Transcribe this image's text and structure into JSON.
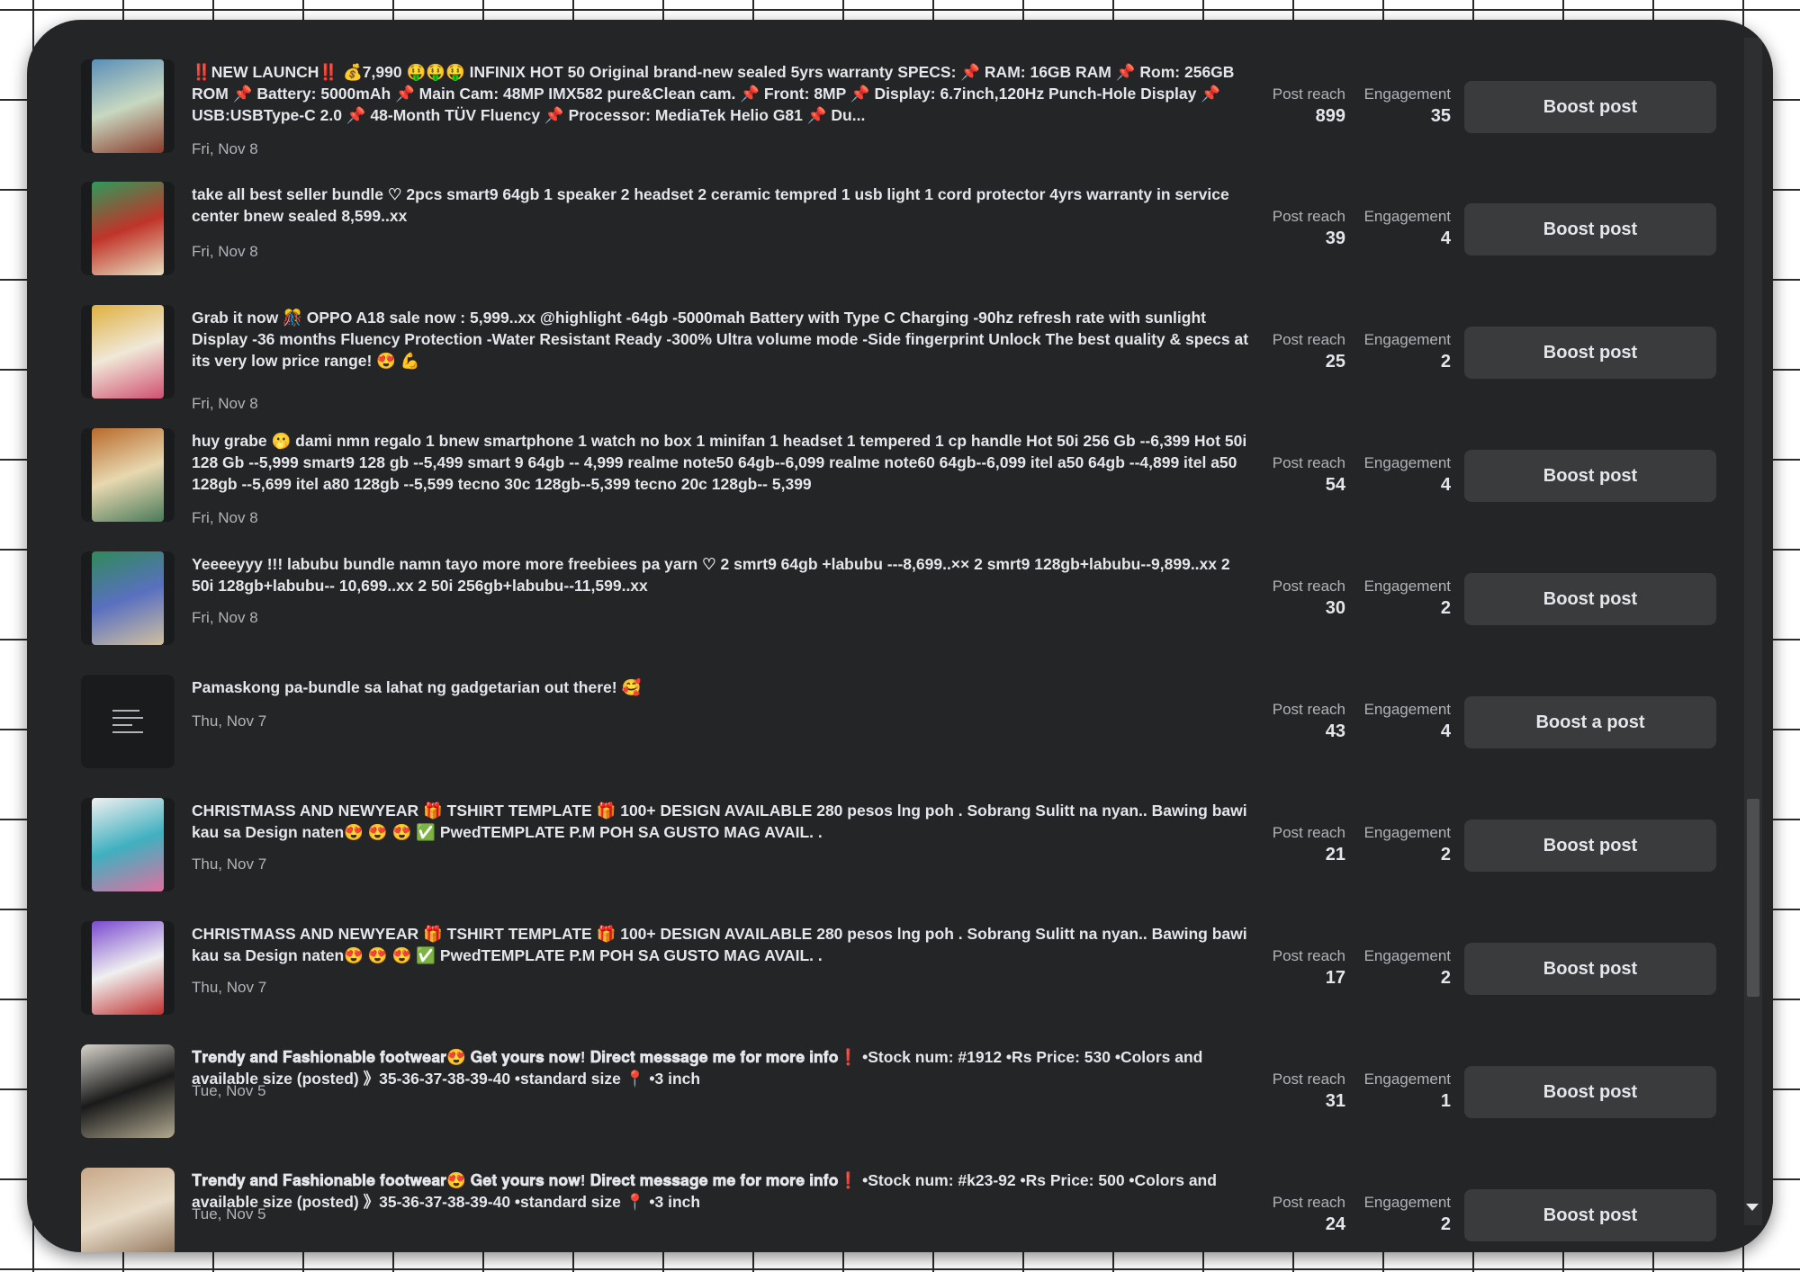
{
  "labels": {
    "reach": "Post reach",
    "engagement": "Engagement"
  },
  "posts": [
    {
      "text": "‼️NEW LAUNCH‼️ 💰7,990 🤑🤑🤑 INFINIX HOT 50 Original brand-new sealed 5yrs warranty SPECS: 📌 RAM: 16GB RAM 📌 Rom: 256GB ROM 📌 Battery: 5000mAh 📌 Main Cam: 48MP IMX582 pure&Clean cam. 📌 Front: 8MP 📌 Display: 6.7inch,120Hz Punch-Hole Display 📌 USB:USBType-C 2.0 📌 48-Month TÜV Fluency 📌 Processor: MediaTek Helio G81 📌 Du...",
      "date": "Fri, Nov 8",
      "reach": "899",
      "engagement": "35",
      "button": "Boost post",
      "thumb": {
        "type": "photo",
        "colors": [
          "#5a8fb8",
          "#c8d8c0",
          "#8a3a2a"
        ]
      }
    },
    {
      "text": "take all best seller bundle ♡ 2pcs smart9 64gb 1 speaker 2 headset 2 ceramic tempred 1 usb light 1 cord protector 4yrs warranty in service center bnew sealed 8,599..xx",
      "date": "Fri, Nov 8",
      "reach": "39",
      "engagement": "4",
      "button": "Boost post",
      "thumb": {
        "type": "photo",
        "colors": [
          "#2f9a5a",
          "#c0342a",
          "#e8e0c0"
        ]
      }
    },
    {
      "text": "Grab it now 🎊 OPPO A18 sale now : 5,999..xx @highlight -64gb -5000mah Battery with Type C Charging -90hz refresh rate with sunlight Display -36 months Fluency Protection -Water Resistant Ready -300% Ultra volume mode -Side fingerprint Unlock The best quality & specs at its very low price range! 😍 💪",
      "date": "Fri, Nov 8",
      "reach": "25",
      "engagement": "2",
      "button": "Boost post",
      "thumb": {
        "type": "photo",
        "colors": [
          "#e0b040",
          "#f0e8d8",
          "#d05070"
        ]
      }
    },
    {
      "text": "huy grabe 🫢 dami nmn regalo 1 bnew smartphone 1 watch no box 1 minifan 1 headset 1 tempered 1 cp handle Hot 50i 256 Gb --6,399 Hot 50i 128 Gb --5,999 smart9 128 gb --5,499 smart 9 64gb -- 4,999 realme note50 64gb--6,099 realme note60 64gb--6,099 itel a50 64gb --4,899 itel a50 128gb --5,699 itel a80 128gb --5,599 tecno 30c 128gb--5,399 tecno 20c 128gb-- 5,399",
      "date": "Fri, Nov 8",
      "reach": "54",
      "engagement": "4",
      "button": "Boost post",
      "thumb": {
        "type": "photo",
        "colors": [
          "#b86a2a",
          "#e8d8b0",
          "#4a7a5a"
        ]
      }
    },
    {
      "text": "Yeeeeyyy !!! labubu bundle namn tayo more more freebiees pa yarn ♡ 2 smrt9 64gb +labubu ---8,699..×× 2 smrt9 128gb+labubu--9,899..xx 2 50i 128gb+labubu-- 10,699..xx 2 50i 256gb+labubu--11,599..xx",
      "date": "Fri, Nov 8",
      "reach": "30",
      "engagement": "2",
      "button": "Boost post",
      "thumb": {
        "type": "photo",
        "colors": [
          "#2f8a5a",
          "#5a70c0",
          "#d0c0a0"
        ]
      }
    },
    {
      "text": "Pamaskong pa-bundle sa lahat ng gadgetarian out there! 🥰",
      "date": "Thu, Nov 7",
      "reach": "43",
      "engagement": "4",
      "button": "Boost a post",
      "thumb": {
        "type": "text-icon",
        "colors": []
      }
    },
    {
      "text": "CHRISTMASS AND NEWYEAR 🎁 TSHIRT TEMPLATE 🎁 100+ DESIGN AVAILABLE 280 pesos lng poh . Sobrang Sulitt na nyan.. Bawing bawi kau sa Design naten😍 😍 😍 ✅ PwedTEMPLATE P.M POH SA GUSTO MAG AVAIL. .",
      "date": "Thu, Nov 7",
      "reach": "21",
      "engagement": "2",
      "button": "Boost post",
      "thumb": {
        "type": "photo",
        "colors": [
          "#f0f0f0",
          "#40b0c0",
          "#e070a0"
        ]
      }
    },
    {
      "text": "CHRISTMASS AND NEWYEAR 🎁 TSHIRT TEMPLATE 🎁 100+ DESIGN AVAILABLE 280 pesos lng poh . Sobrang Sulitt na nyan.. Bawing bawi kau sa Design naten😍 😍 😍 ✅ PwedTEMPLATE P.M POH SA GUSTO MAG AVAIL. .",
      "date": "Thu, Nov 7",
      "reach": "17",
      "engagement": "2",
      "button": "Boost post",
      "thumb": {
        "type": "photo",
        "colors": [
          "#7a4ad0",
          "#f0f0f0",
          "#c03030"
        ]
      }
    },
    {
      "text": "𝐓𝐫𝐞𝐧𝐝𝐲 𝐚𝐧𝐝 𝐅𝐚𝐬𝐡𝐢𝐨𝐧𝐚𝐛𝐥𝐞 𝐟𝐨𝐨𝐭𝐰𝐞𝐚𝐫😍 𝐆𝐞𝐭 𝐲𝐨𝐮𝐫𝐬 𝐧𝐨𝐰! 𝐃𝐢𝐫𝐞𝐜𝐭 𝐦𝐞𝐬𝐬𝐚𝐠𝐞 𝐦𝐞 𝐟𝐨𝐫 𝐦𝐨𝐫𝐞 𝐢𝐧𝐟𝐨❗ •Stock num: #1912 •Rs Price: 530 •Colors and available size (posted) 》35-36-37-38-39-40 •standard size 📍 •3 inch",
      "date": "Tue, Nov 5",
      "reach": "31",
      "engagement": "1",
      "button": "Boost post",
      "thumb": {
        "type": "photo-wide",
        "colors": [
          "#d8d4cc",
          "#1a1a1a",
          "#b0a890"
        ]
      }
    },
    {
      "text": "𝐓𝐫𝐞𝐧𝐝𝐲 𝐚𝐧𝐝 𝐅𝐚𝐬𝐡𝐢𝐨𝐧𝐚𝐛𝐥𝐞 𝐟𝐨𝐨𝐭𝐰𝐞𝐚𝐫😍 𝐆𝐞𝐭 𝐲𝐨𝐮𝐫𝐬 𝐧𝐨𝐰! 𝐃𝐢𝐫𝐞𝐜𝐭 𝐦𝐞𝐬𝐬𝐚𝐠𝐞 𝐦𝐞 𝐟𝐨𝐫 𝐦𝐨𝐫𝐞 𝐢𝐧𝐟𝐨❗ •Stock num: #k23-92 •Rs Price: 500 •Colors and available size (posted) 》35-36-37-38-39-40 •standard size 📍 •3 inch",
      "date": "Tue, Nov 5",
      "reach": "24",
      "engagement": "2",
      "button": "Boost post",
      "thumb": {
        "type": "photo-wide",
        "colors": [
          "#c8a888",
          "#e8dcc8",
          "#8a6a50"
        ]
      }
    }
  ]
}
